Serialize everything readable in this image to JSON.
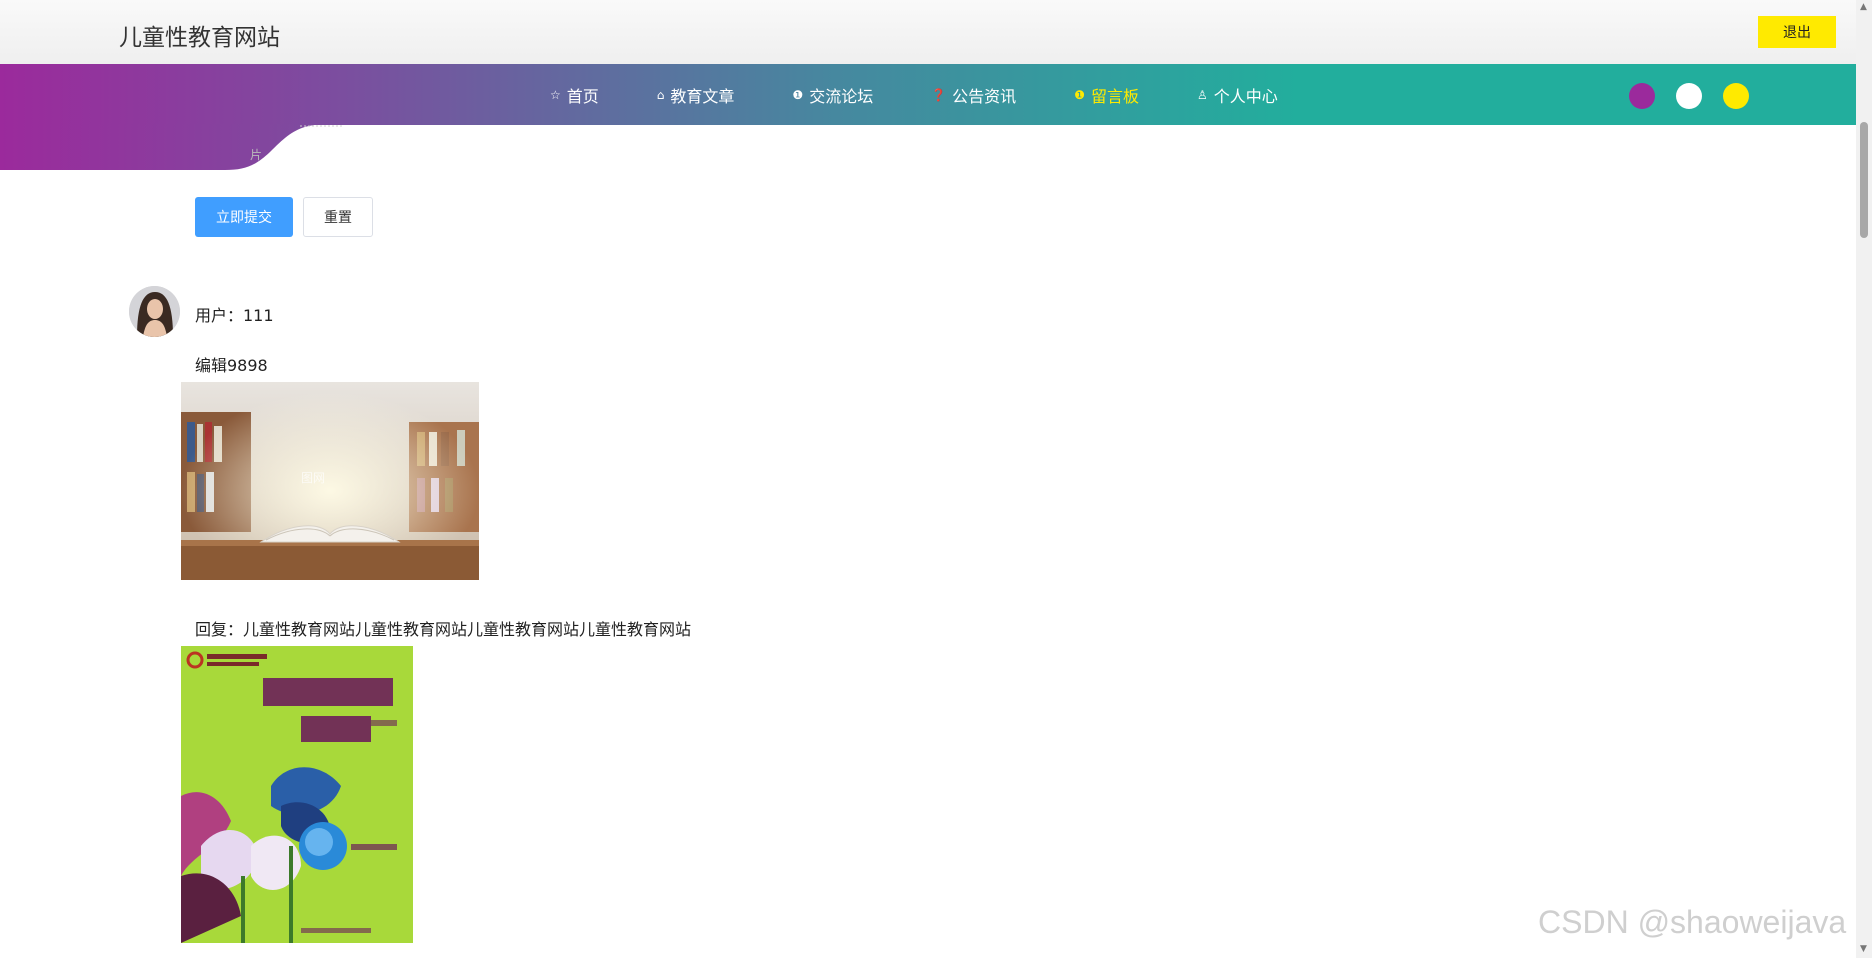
{
  "header": {
    "site_title": "儿童性教育网站",
    "logout_label": "退出"
  },
  "nav": {
    "items": [
      {
        "label": "首页",
        "icon": "star-outline-icon",
        "glyph": "☆",
        "active": false
      },
      {
        "label": "教育文章",
        "icon": "lock-icon",
        "glyph": "⌂",
        "active": false
      },
      {
        "label": "交流论坛",
        "icon": "info-circle-icon",
        "glyph": "❶",
        "active": false
      },
      {
        "label": "公告资讯",
        "icon": "question-circle-icon",
        "glyph": "❓",
        "active": false
      },
      {
        "label": "留言板",
        "icon": "info-circle-icon",
        "glyph": "❶",
        "active": true
      },
      {
        "label": "个人中心",
        "icon": "user-icon",
        "glyph": "♙",
        "active": false
      }
    ],
    "theme_colors": [
      "#9b2a9c",
      "#ffffff",
      "#ffea00"
    ]
  },
  "form": {
    "faint_label": "片",
    "submit_label": "立即提交",
    "reset_label": "重置"
  },
  "message": {
    "user_line": "用户：111",
    "content": "编辑9898",
    "reply": "回复：儿童性教育网站儿童性教育网站儿童性教育网站儿童性教育网站"
  },
  "images": {
    "book_watermark": "图网"
  },
  "watermark": "CSDN @shaoweijava"
}
